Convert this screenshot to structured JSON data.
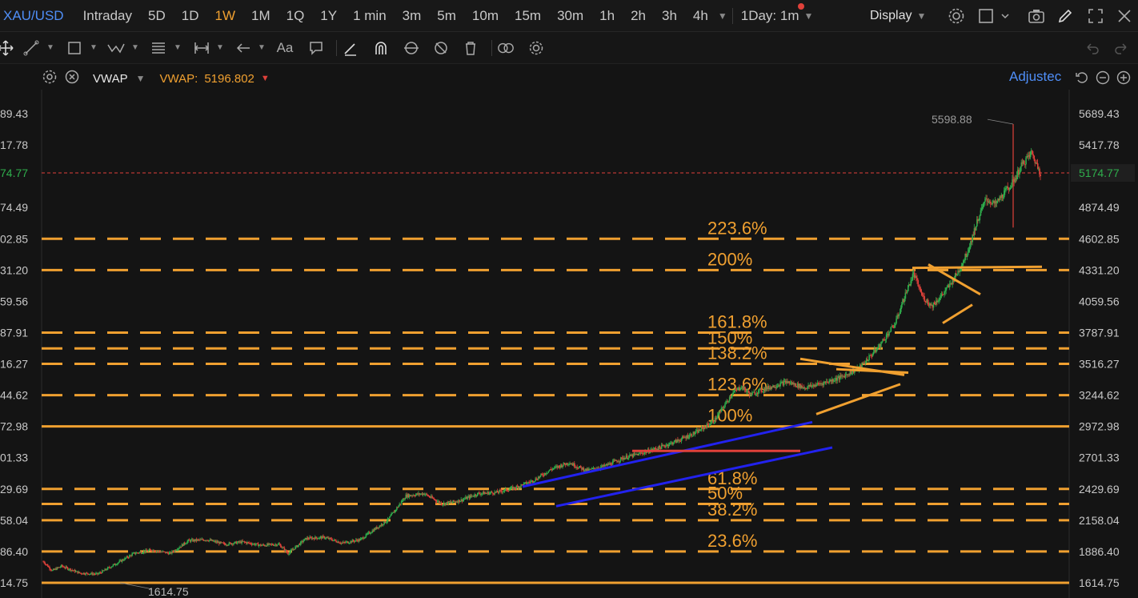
{
  "header": {
    "symbol": "XAU/USD",
    "intervals": [
      "Intraday",
      "5D",
      "1D",
      "1W",
      "1M",
      "1Q",
      "1Y",
      "1 min",
      "3m",
      "5m",
      "10m",
      "15m",
      "30m",
      "1h",
      "2h",
      "3h",
      "4h"
    ],
    "active_interval": "1W",
    "chart_interval": "1Day: 1m",
    "display_label": "Display"
  },
  "indicator": {
    "name": "VWAP",
    "label": "VWAP:",
    "value": "5196.802",
    "adjusted_label": "Adjustec"
  },
  "price_axis": {
    "right_labels": [
      "5689.43",
      "5417.78",
      "5174.77",
      "4874.49",
      "4602.85",
      "4331.20",
      "4059.56",
      "3787.91",
      "3516.27",
      "3244.62",
      "2972.98",
      "2701.33",
      "2429.69",
      "2158.04",
      "1886.40",
      "1614.75"
    ],
    "left_labels": [
      "89.43",
      "17.78",
      "74.77",
      "74.49",
      "02.85",
      "31.20",
      "59.56",
      "87.91",
      "16.27",
      "44.62",
      "72.98",
      "01.33",
      "29.69",
      "58.04",
      "86.40",
      "14.75"
    ],
    "current_price": "5174.77",
    "high_marker": "5598.88",
    "low_marker": "1614.75"
  },
  "fib_levels": [
    {
      "label": "223.6%",
      "price": 4602.85
    },
    {
      "label": "200%",
      "price": 4331.2
    },
    {
      "label": "161.8%",
      "price": 3787.91
    },
    {
      "label": "150%",
      "price": 3650
    },
    {
      "label": "138.2%",
      "price": 3516.27
    },
    {
      "label": "123.6%",
      "price": 3244.62
    },
    {
      "label": "100%",
      "price": 2972.98
    },
    {
      "label": "61.8%",
      "price": 2429.69
    },
    {
      "label": "50%",
      "price": 2300
    },
    {
      "label": "38.2%",
      "price": 2158.04
    },
    {
      "label": "23.6%",
      "price": 1886.4
    }
  ],
  "colors": {
    "accent": "#f0a030",
    "up": "#2fae4c",
    "down": "#e0413a",
    "trend_blue": "#2222ee",
    "link": "#4f8ef7"
  }
}
